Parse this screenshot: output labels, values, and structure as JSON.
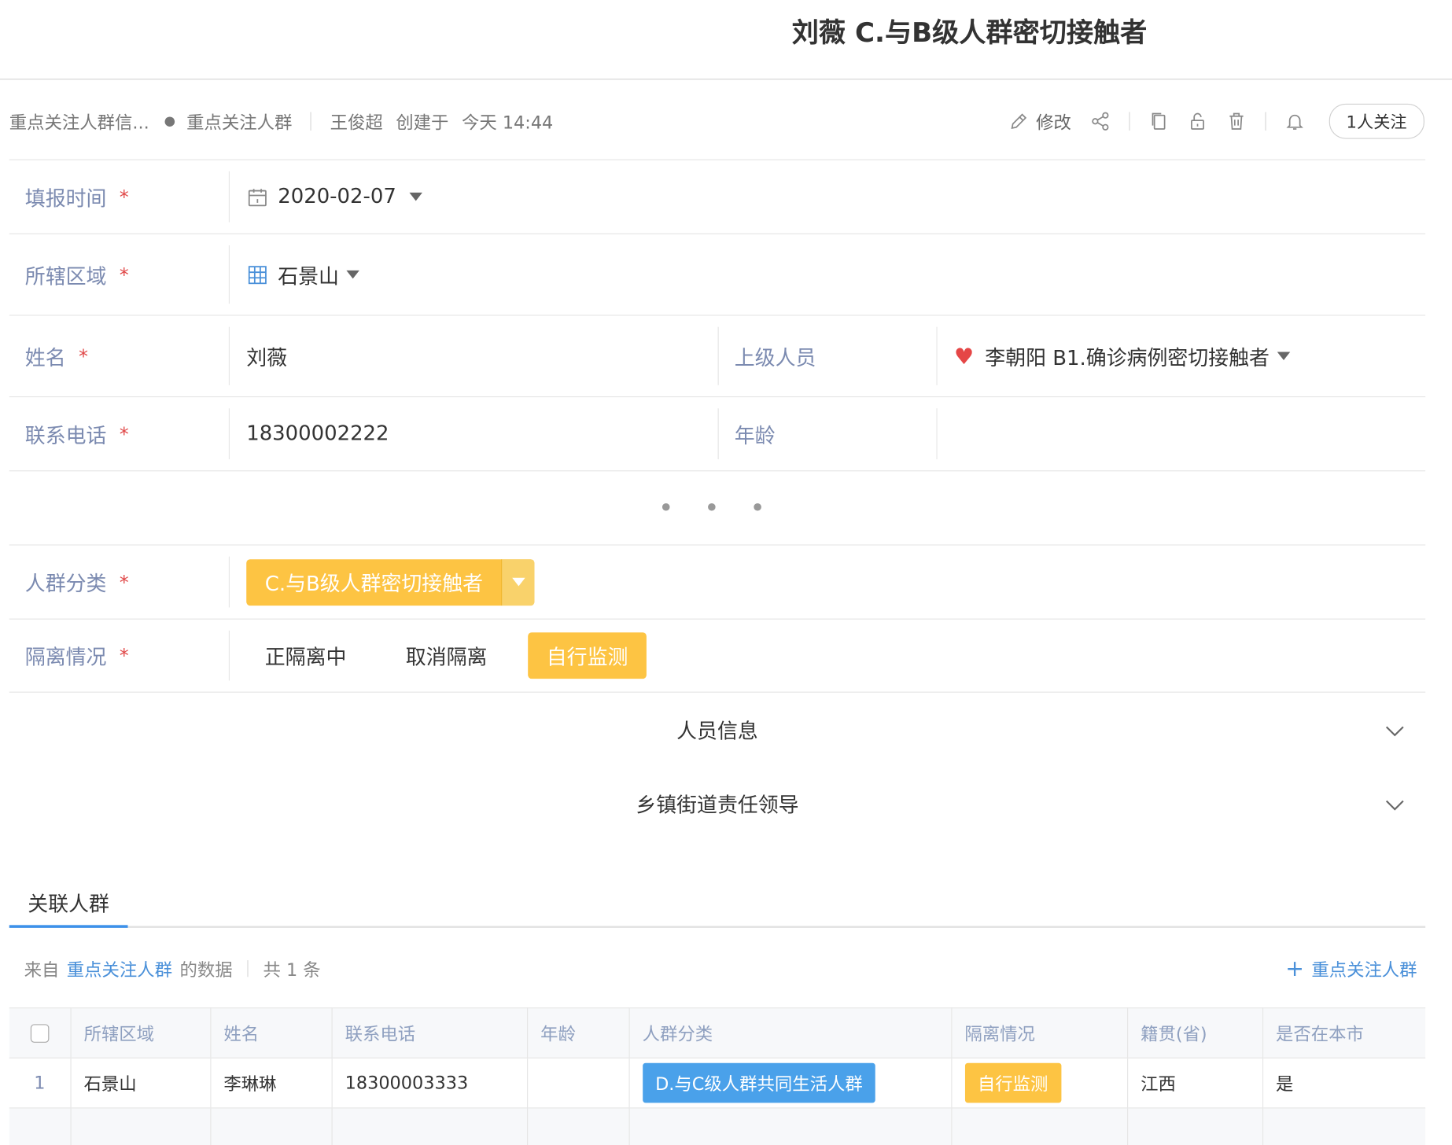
{
  "title": "刘薇 C.与B级人群密切接触者",
  "meta": {
    "crumb1": "重点关注人群信...",
    "crumb2": "重点关注人群",
    "creator": "王俊超",
    "created_label": "创建于",
    "created_time": "今天 14:44",
    "edit_label": "修改",
    "follow_label": "1人关注"
  },
  "fields": {
    "fill_time": {
      "label": "填报时间",
      "value": "2020-02-07"
    },
    "region": {
      "label": "所辖区域",
      "value": "石景山"
    },
    "name": {
      "label": "姓名",
      "value": "刘薇"
    },
    "superior": {
      "label": "上级人员",
      "value": "李朝阳 B1.确诊病例密切接触者"
    },
    "phone": {
      "label": "联系电话",
      "value": "18300002222"
    },
    "age": {
      "label": "年龄",
      "value": ""
    },
    "more": "• • •",
    "group": {
      "label": "人群分类",
      "value": "C.与B级人群密切接触者"
    },
    "isolation": {
      "label": "隔离情况",
      "options": [
        "正隔离中",
        "取消隔离",
        "自行监测"
      ],
      "selected": "自行监测"
    },
    "required_mark": "*"
  },
  "sections": {
    "person_info": "人员信息",
    "leader": "乡镇街道责任领导"
  },
  "tab": {
    "label": "关联人群"
  },
  "ref": {
    "from": "来自",
    "source": "重点关注人群",
    "data_suffix": "的数据",
    "count": "共 1 条",
    "add_label": "重点关注人群"
  },
  "table": {
    "headers": [
      "所辖区域",
      "姓名",
      "联系电话",
      "年龄",
      "人群分类",
      "隔离情况",
      "籍贯(省)",
      "是否在本市"
    ],
    "rows": [
      {
        "index": "1",
        "region": "石景山",
        "name": "李琳琳",
        "phone": "18300003333",
        "age": "",
        "group": "D.与C级人群共同生活人群",
        "isolation": "自行监测",
        "province": "江西",
        "in_city": "是"
      }
    ]
  },
  "colors": {
    "accent": "#fdc443",
    "link": "#4a90d9",
    "tag_blue": "#4aa1ea",
    "label": "#7b8ab0",
    "required": "#e04848"
  }
}
